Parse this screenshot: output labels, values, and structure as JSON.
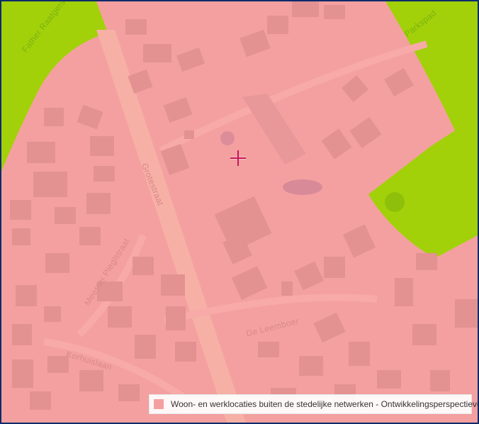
{
  "map": {
    "colors": {
      "zone_fill": "#f4a0a0",
      "green_fill": "#a2d10a",
      "building": "#e39191",
      "road": "#f7b0a5",
      "crosshair": "#c4185c",
      "frame": "#0d2a6b"
    },
    "streets": {
      "father_raaijmakersstraat": "Father Raatgerstraat",
      "parkspad": "Parkspad",
      "grotestraat": "Grotestraat",
      "meester_pieglstraat": "Meester Pieglstraat",
      "de_leemboer": "De Leemboer",
      "korhuislaan": "Korhuislaan"
    }
  },
  "legend": {
    "items": [
      {
        "label": "Woon- en werklocaties buiten de stedelijke netwerken - Ontwikkelingsperspectieven (Waar)",
        "color": "#f4a0a0"
      }
    ]
  }
}
